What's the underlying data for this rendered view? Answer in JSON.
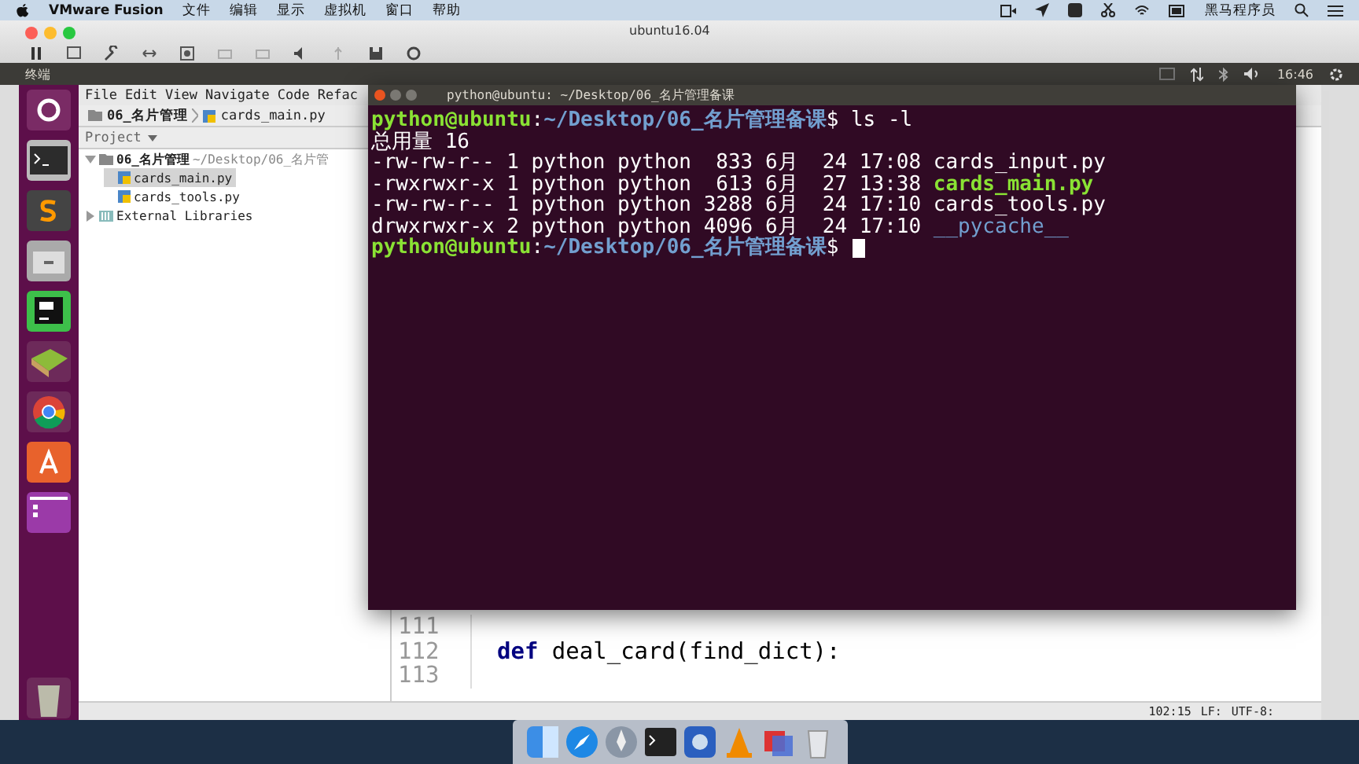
{
  "menubar": {
    "app": "VMware Fusion",
    "menus": [
      "文件",
      "编辑",
      "显示",
      "虚拟机",
      "窗口",
      "帮助"
    ],
    "user": "黑马程序员"
  },
  "vm_window": {
    "title": "ubuntu16.04"
  },
  "ubuntu_panel": {
    "title": "终端",
    "time": "16:46"
  },
  "pycharm": {
    "menus": [
      "File",
      "Edit",
      "View",
      "Navigate",
      "Code",
      "Refac"
    ],
    "breadcrumb": [
      "06_名片管理",
      "cards_main.py"
    ],
    "project_label": "Project",
    "tree": [
      {
        "label": "06_名片管理",
        "hint": "~/Desktop/06_名片管",
        "kind": "folder",
        "expanded": true,
        "selected": false,
        "children": [
          {
            "label": "cards_main.py",
            "kind": "py",
            "selected": true
          },
          {
            "label": "cards_tools.py",
            "kind": "py",
            "selected": false
          }
        ]
      },
      {
        "label": "External Libraries",
        "kind": "lib",
        "expanded": false,
        "selected": false
      }
    ],
    "editor": {
      "lines": [
        {
          "number": "111"
        },
        {
          "number": "112",
          "code": "**def** deal_card(find_dict):"
        },
        {
          "number": "113"
        }
      ]
    },
    "status_bar": {
      "position": "102:15",
      "line_sep": "LF:",
      "encoding": "UTF-8:"
    }
  },
  "terminal": {
    "title": "python@ubuntu: ~/Desktop/06_名片管理备课",
    "lines": [
      {
        "kind": "prompt",
        "user": "python@ubuntu",
        "sep": ":",
        "path": "~/Desktop/06_名片管理备课",
        "command": "$ ls -l",
        "cursor": false
      },
      {
        "kind": "text",
        "text": "总用量 16"
      },
      {
        "kind": "entry",
        "info": "-rw-rw-r-- 1 python python  833 6月  24 17:08 ",
        "name": "cards_input.py",
        "color": "#ffffff",
        "bold": false
      },
      {
        "kind": "entry",
        "info": "-rwxrwxr-x 1 python python  613 6月  27 13:38 ",
        "name": "cards_main.py",
        "color": "#8ae234",
        "bold": true
      },
      {
        "kind": "entry",
        "info": "-rw-rw-r-- 1 python python 3288 6月  24 17:10 ",
        "name": "cards_tools.py",
        "color": "#ffffff",
        "bold": false
      },
      {
        "kind": "entry",
        "info": "drwxrwxr-x 2 python python 4096 6月  24 17:10 ",
        "name": "__pycache__",
        "color": "#729fcf",
        "bold": false
      },
      {
        "kind": "prompt",
        "user": "python@ubuntu",
        "sep": ":",
        "path": "~/Desktop/06_名片管理备课",
        "command": "$ ",
        "cursor": true
      }
    ]
  }
}
